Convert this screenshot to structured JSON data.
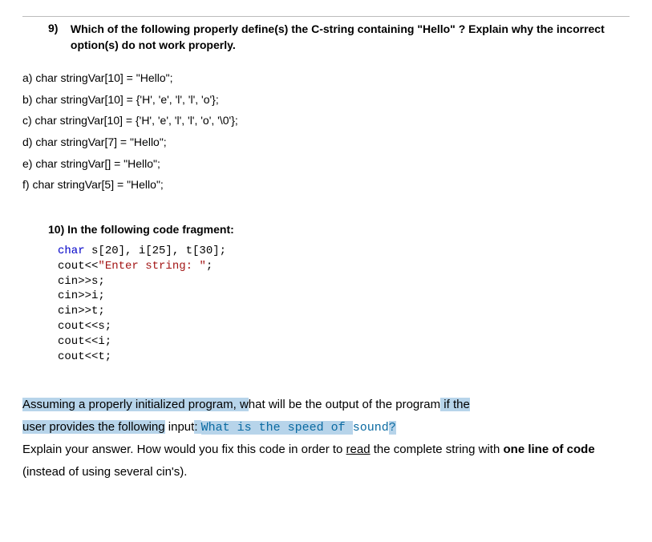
{
  "q9": {
    "number": "9)",
    "prompt": "Which of the following properly define(s) the C-string containing \"Hello\" ? Explain why the incorrect option(s) do not work properly.",
    "options": {
      "a": "a) char stringVar[10] = \"Hello\";",
      "b": "b) char stringVar[10] = {'H', 'e', 'l', 'l', 'o'};",
      "c": "c) char stringVar[10] = {'H', 'e', 'l', 'l', 'o', '\\0'};",
      "d": "d) char stringVar[7] = \"Hello\";",
      "e": "e) char stringVar[] = \"Hello\";",
      "f": "f) char stringVar[5] = \"Hello\";"
    }
  },
  "q10": {
    "header": "10) In the following code fragment:",
    "code": {
      "kw_char": "char",
      "decl_rest": " s[20], i[25], t[30];",
      "cout_prefix": "cout<<",
      "str_literal": "\"Enter string: \"",
      "semi": ";",
      "lines_after": [
        "cin>>s;",
        "cin>>i;",
        "cin>>t;",
        "cout<<s;",
        "cout<<i;",
        "cout<<t;"
      ]
    },
    "explain": {
      "p1_a": "Assuming a properly initialized program, w",
      "p1_b": "hat will be the output of the program",
      "p1_c": " if the ",
      "p2_a": "user provides the following",
      "p2_b": " input",
      "p2_colon": ": ",
      "p2_code_hl": "What is the speed of ",
      "p2_code_plain": "sound",
      "p2_code_q_hl": "?",
      "p3": "Explain your answer.  How would you fix this code in order to ",
      "p3_u": "read",
      "p3_b": " the complete string with ",
      "p3_bold": "one line of code",
      "p3_c": " (instead of using several cin's)."
    }
  }
}
